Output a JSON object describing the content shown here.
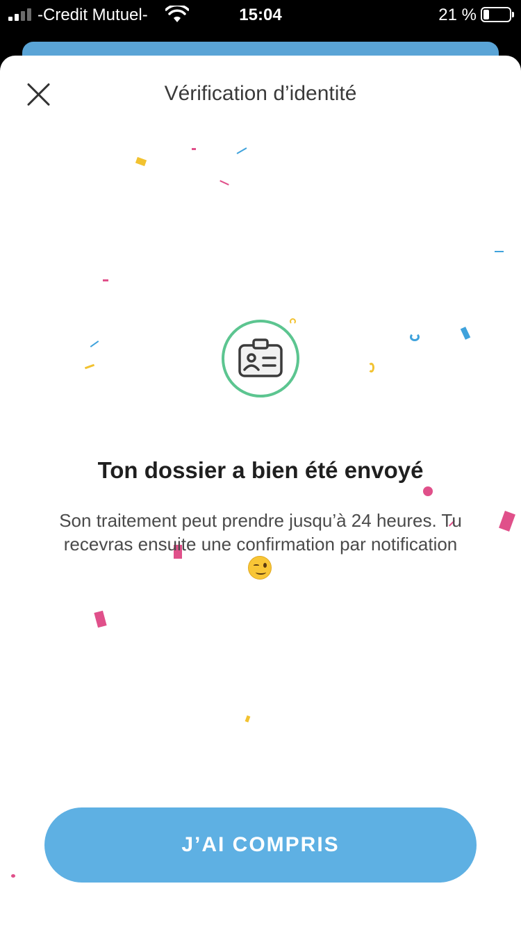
{
  "status_bar": {
    "carrier": "-Credit Mutuel-",
    "time": "15:04",
    "battery_percent": "21 %",
    "battery_level": 0.21,
    "signal_bars_active": 2,
    "signal_bars_total": 4
  },
  "sheet": {
    "title": "Vérification d’identité",
    "close_icon": "close-icon",
    "badge_icon": "id-card-icon",
    "headline": "Ton dossier a bien été envoyé",
    "message": "Son traitement peut prendre jusqu’à 24 heures. Tu recevras ensuite une confirmation par notification",
    "emoji_icon": "winking-face-icon",
    "button_label": "J’AI COMPRIS"
  },
  "colors": {
    "accent_blue": "#5eb0e3",
    "badge_green": "#5cc590",
    "confetti_pink": "#e0508a",
    "confetti_yellow": "#f2c230",
    "confetti_blue": "#3fa2dc"
  }
}
